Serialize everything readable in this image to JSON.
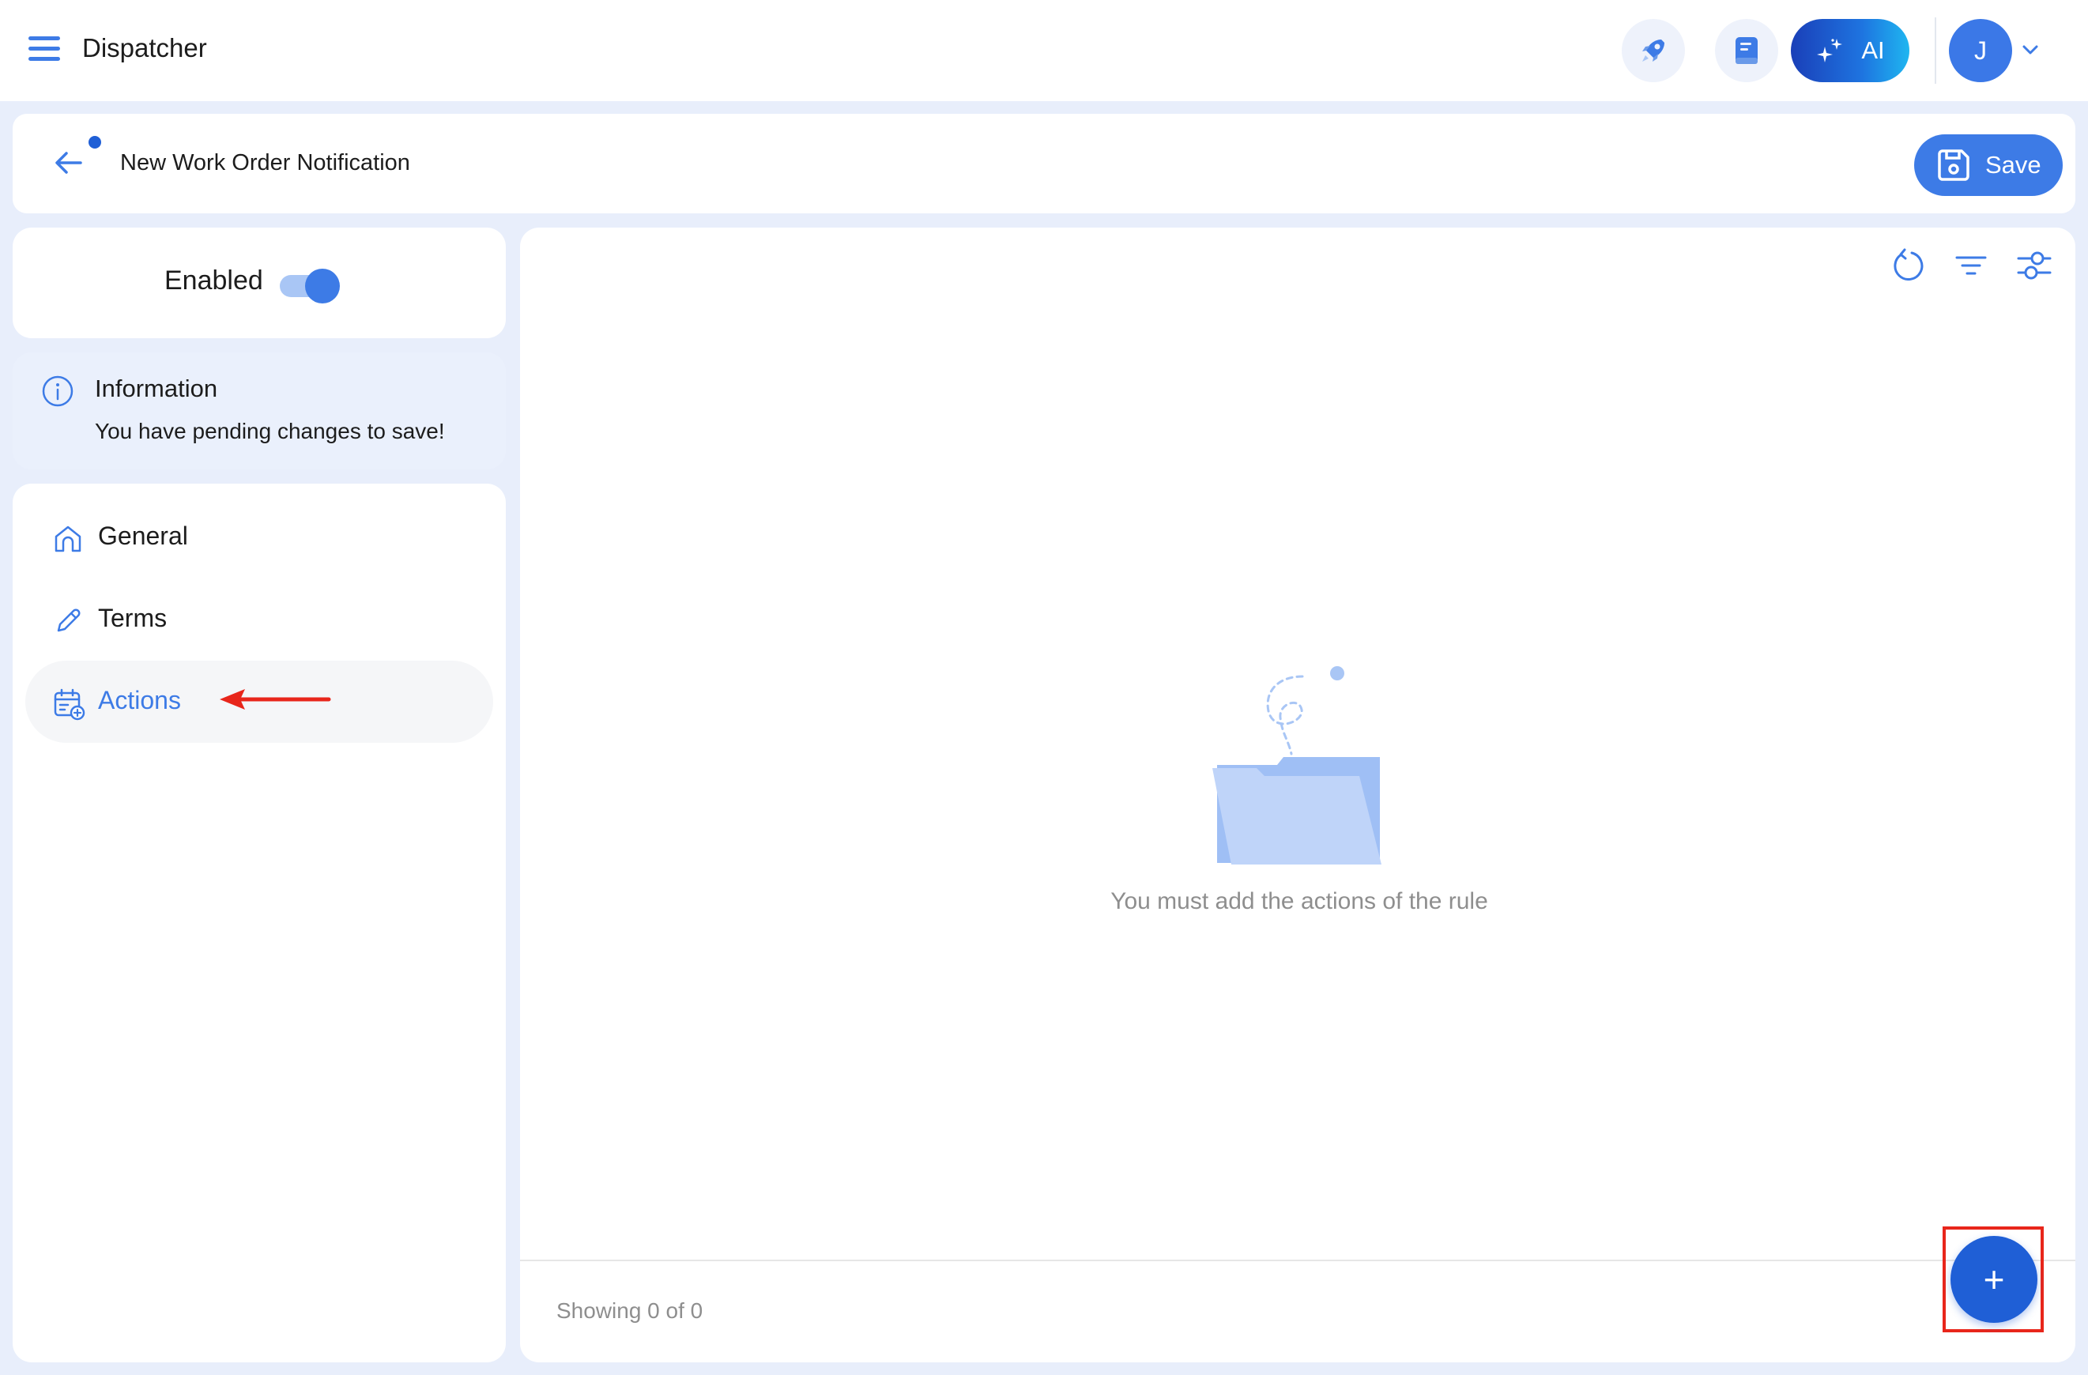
{
  "app": {
    "title": "Dispatcher"
  },
  "topbar": {
    "ai_label": "AI",
    "avatar_initial": "J",
    "icons": [
      "menu-icon",
      "rocket-icon",
      "notebook-icon",
      "sparkle-icon",
      "chevron-down-icon"
    ]
  },
  "header": {
    "title": "New Work Order Notification",
    "save_label": "Save"
  },
  "status": {
    "enabled_label": "Enabled",
    "enabled": true
  },
  "info": {
    "title": "Information",
    "message": "You have pending changes to save!"
  },
  "nav": {
    "items": [
      {
        "label": "General",
        "icon": "home-icon",
        "active": false
      },
      {
        "label": "Terms",
        "icon": "pencil-icon",
        "active": false
      },
      {
        "label": "Actions",
        "icon": "calendar-add-icon",
        "active": true
      }
    ]
  },
  "main": {
    "toolbar_icons": [
      "refresh-icon",
      "filter-icon",
      "settings-sliders-icon"
    ],
    "empty_message": "You must add the actions of the rule",
    "showing": "Showing 0 of 0",
    "fab_label": "+"
  },
  "colors": {
    "accent": "#3d7be6",
    "accent_dark": "#1f5fd6",
    "background": "#e8eefb",
    "annotation_red": "#e8261b"
  }
}
